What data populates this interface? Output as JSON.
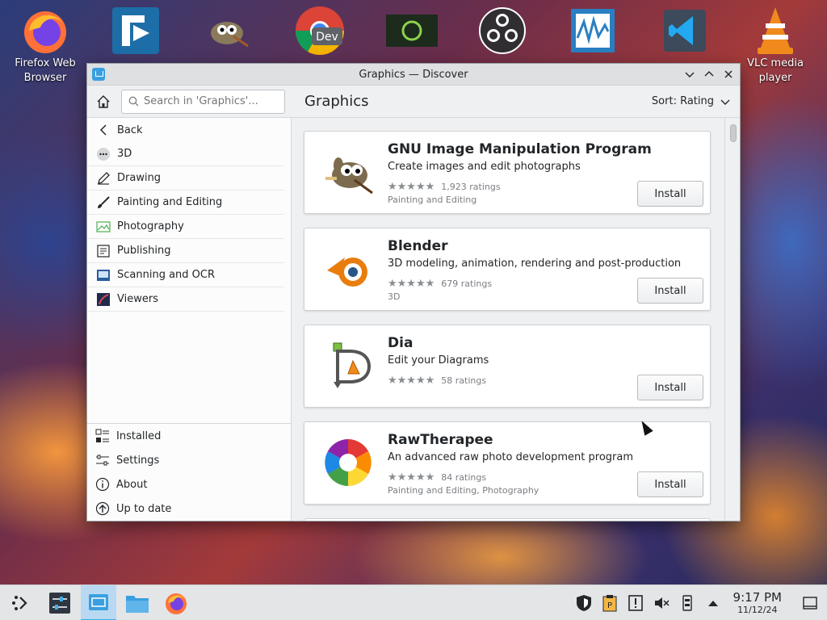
{
  "desktop": {
    "icons": [
      {
        "id": "firefox",
        "label": "Firefox Web Browser"
      },
      {
        "id": "freefilesync",
        "label": ""
      },
      {
        "id": "gimp",
        "label": ""
      },
      {
        "id": "chrome-dev",
        "label": "",
        "badge": "Dev"
      },
      {
        "id": "linux-mint",
        "label": ""
      },
      {
        "id": "obs",
        "label": ""
      },
      {
        "id": "wavemaker",
        "label": ""
      },
      {
        "id": "vscode",
        "label": ""
      },
      {
        "id": "vlc",
        "label": "VLC media player"
      }
    ]
  },
  "window": {
    "title": "Graphics — Discover",
    "controls": [
      "minimize",
      "maximize",
      "close"
    ]
  },
  "toolbar": {
    "search_placeholder": "Search in 'Graphics'...",
    "page_title": "Graphics",
    "sort_label": "Sort: Rating"
  },
  "sidebar": {
    "items": [
      {
        "label": "Back",
        "icon": "chevron-left-icon"
      },
      {
        "label": "3D",
        "icon": "3d-icon"
      },
      {
        "label": "Drawing",
        "icon": "drawing-icon"
      },
      {
        "label": "Painting and Editing",
        "icon": "brush-icon"
      },
      {
        "label": "Photography",
        "icon": "photo-icon"
      },
      {
        "label": "Publishing",
        "icon": "publishing-icon"
      },
      {
        "label": "Scanning and OCR",
        "icon": "scanner-icon"
      },
      {
        "label": "Viewers",
        "icon": "viewer-icon"
      }
    ],
    "bottom": [
      {
        "label": "Installed",
        "icon": "installed-icon"
      },
      {
        "label": "Settings",
        "icon": "settings-icon"
      },
      {
        "label": "About",
        "icon": "about-icon"
      },
      {
        "label": "Up to date",
        "icon": "up-to-date-icon"
      }
    ]
  },
  "apps": [
    {
      "name": "GNU Image Manipulation Program",
      "description": "Create images and edit photographs",
      "ratings": "1,923 ratings",
      "category": "Painting and Editing",
      "install_label": "Install"
    },
    {
      "name": "Blender",
      "description": "3D modeling, animation, rendering and post-production",
      "ratings": "679 ratings",
      "category": "3D",
      "install_label": "Install"
    },
    {
      "name": "Dia",
      "description": "Edit your Diagrams",
      "ratings": "58 ratings",
      "category": "",
      "install_label": "Install"
    },
    {
      "name": "RawTherapee",
      "description": "An advanced raw photo development program",
      "ratings": "84 ratings",
      "category": "Painting and Editing, Photography",
      "install_label": "Install"
    }
  ],
  "stars": "★★★★★",
  "taskbar": {
    "clock_time": "9:17 PM",
    "clock_date": "11/12/24"
  },
  "colors": {
    "accent": "#3daee9",
    "window_bg": "#eff0f1",
    "card_bg": "#ffffff",
    "text": "#232629"
  }
}
